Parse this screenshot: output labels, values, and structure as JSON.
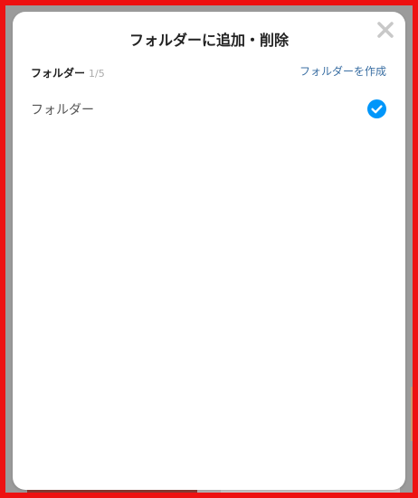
{
  "dialog": {
    "title": "フォルダーに追加・削除",
    "close_icon": "close-icon",
    "folder_header": {
      "label": "フォルダー",
      "count": "1/5",
      "create_link": "フォルダーを作成"
    },
    "folders": [
      {
        "name": "フォルダー",
        "checked": true
      }
    ]
  },
  "colors": {
    "accent": "#0096fa",
    "link": "#3b6fa3",
    "highlight_border": "#ee1111",
    "overlay": "#9b9b9b"
  }
}
